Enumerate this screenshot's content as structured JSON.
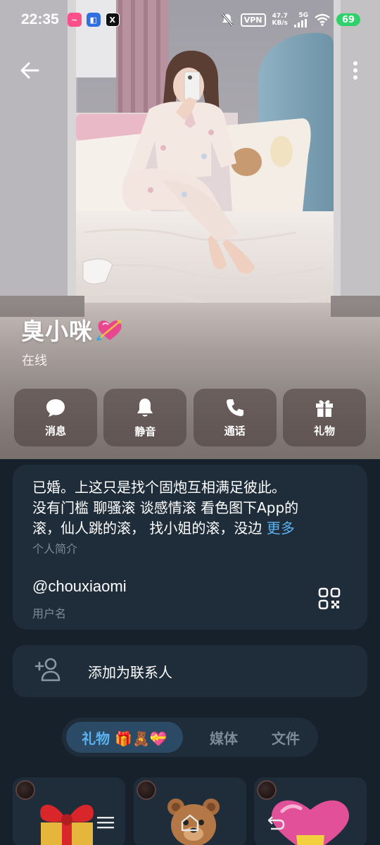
{
  "status_bar": {
    "time": "22:35",
    "vpn_label": "VPN",
    "net_speed_value": "47.7",
    "net_speed_unit": "KB/s",
    "signal_label": "5G",
    "battery": "69",
    "battery_color": "#2fd16b"
  },
  "profile": {
    "name": "臭小咪",
    "presence": "在线"
  },
  "actions": [
    {
      "label": "消息",
      "icon": "chat-bubble-icon"
    },
    {
      "label": "静音",
      "icon": "bell-icon"
    },
    {
      "label": "通话",
      "icon": "phone-icon"
    },
    {
      "label": "礼物",
      "icon": "gift-icon"
    }
  ],
  "info": {
    "bio_line1": "已婚。上这只是找个固炮互相满足彼此。",
    "bio_line2": "没有门槛 聊骚滚 谈感情滚 看色图下App的",
    "bio_line3": "滚，仙人跳的滚， 找小姐的滚，没边",
    "bio_more": "更多",
    "bio_label": "个人简介",
    "username": "@chouxiaomi",
    "username_label": "用户名"
  },
  "add_contact": {
    "label": "添加为联系人"
  },
  "tabs": {
    "gifts": "礼物 🎁🧸💝",
    "media": "媒体",
    "files": "文件"
  },
  "colors": {
    "accent": "#5ab3f0",
    "card_bg": "#1f2c3a",
    "page_bg": "#17212b",
    "muted_text": "#7d8b99"
  }
}
